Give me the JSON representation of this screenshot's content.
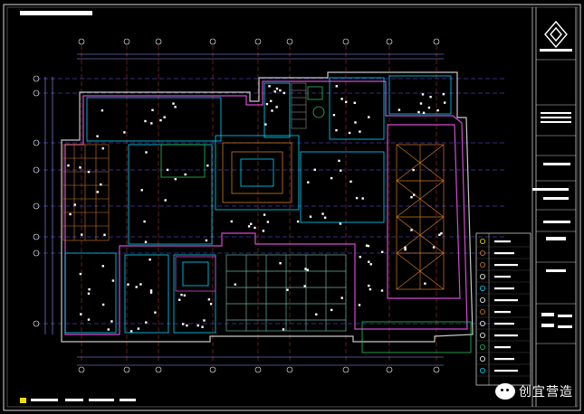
{
  "drawing": {
    "background": "#000000",
    "line_colors": {
      "border": "#d8d8d8",
      "axis": "#6b5cff",
      "dim": "#9aa0ff",
      "wall": "#c8c8c8",
      "cyan": "#00d8ff",
      "magenta": "#d24bd2",
      "green": "#22c35a",
      "orange": "#d07a28",
      "red": "#c83a3a",
      "yellow": "#f0e000"
    }
  },
  "title_block": {
    "logo_icon": "company-logo-icon"
  },
  "watermark": {
    "text": "创宜营造",
    "icon": "wechat-icon"
  }
}
